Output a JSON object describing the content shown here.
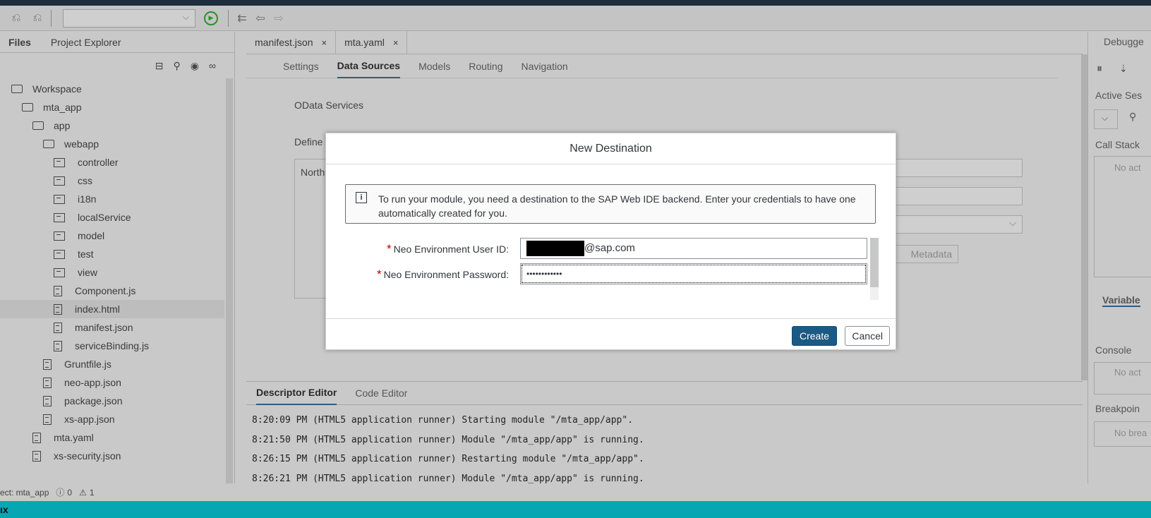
{
  "toolbar": {
    "select_value": ""
  },
  "left_panel": {
    "tabs": [
      "Files",
      "Project Explorer"
    ],
    "tree": [
      {
        "label": "Workspace",
        "kind": "folder"
      },
      {
        "label": "mta_app",
        "kind": "folder"
      },
      {
        "label": "app",
        "kind": "folder"
      },
      {
        "label": "webapp",
        "kind": "folder"
      },
      {
        "label": "controller",
        "kind": "package"
      },
      {
        "label": "css",
        "kind": "package"
      },
      {
        "label": "i18n",
        "kind": "package"
      },
      {
        "label": "localService",
        "kind": "package"
      },
      {
        "label": "model",
        "kind": "package"
      },
      {
        "label": "test",
        "kind": "package"
      },
      {
        "label": "view",
        "kind": "package"
      },
      {
        "label": "Component.js",
        "kind": "file"
      },
      {
        "label": "index.html",
        "kind": "file",
        "selected": true
      },
      {
        "label": "manifest.json",
        "kind": "file"
      },
      {
        "label": "serviceBinding.js",
        "kind": "file"
      },
      {
        "label": "Gruntfile.js",
        "kind": "file"
      },
      {
        "label": "neo-app.json",
        "kind": "file"
      },
      {
        "label": "package.json",
        "kind": "file"
      },
      {
        "label": "xs-app.json",
        "kind": "file"
      },
      {
        "label": "mta.yaml",
        "kind": "file"
      },
      {
        "label": "xs-security.json",
        "kind": "file"
      }
    ]
  },
  "editor": {
    "tabs": [
      {
        "label": "manifest.json",
        "close": "×"
      },
      {
        "label": "mta.yaml",
        "close": "×"
      }
    ],
    "subtabs": [
      "Settings",
      "Data Sources",
      "Models",
      "Routing",
      "Navigation"
    ],
    "active_subtab": "Data Sources",
    "odata_label": "OData Services",
    "define_label": "Define",
    "north_label": "North",
    "metadata_label": "Metadata",
    "descriptor_tabs": [
      "Descriptor Editor",
      "Code Editor"
    ]
  },
  "console": {
    "lines": [
      "8:20:09 PM (HTML5 application runner) Starting module \"/mta_app/app\".",
      "8:21:50 PM (HTML5 application runner) Module \"/mta_app/app\" is running.",
      "8:26:15 PM (HTML5 application runner) Restarting module \"/mta_app/app\".",
      "8:26:21 PM (HTML5 application runner) Module \"/mta_app/app\" is running."
    ]
  },
  "status_bar": {
    "project": "ect: mta_app",
    "errors": "0",
    "warnings": "1"
  },
  "bottom_bar": {
    "label": "ıx"
  },
  "debugger": {
    "title": "Debugge",
    "active_sessions": "Active Ses",
    "call_stack": "Call Stack",
    "call_stack_empty": "No act",
    "variables": "Variable",
    "console": "Console",
    "console_empty": "No act",
    "breakpoints": "Breakpoin",
    "breakpoints_empty": "No brea"
  },
  "dialog": {
    "title": "New Destination",
    "info": "To run your module, you need a destination to the SAP Web IDE backend. Enter your credentials to have one automatically created for you.",
    "user_label": "Neo Environment User ID:",
    "user_value_suffix": "@sap.com",
    "password_label": "Neo Environment Password:",
    "password_value": "••••••••••••",
    "required_mark": "*",
    "create_label": "Create",
    "cancel_label": "Cancel"
  },
  "colors": {
    "primary_button": "#1b5a83",
    "bottom_bar": "#06a7b3",
    "required": "#bb0000"
  }
}
